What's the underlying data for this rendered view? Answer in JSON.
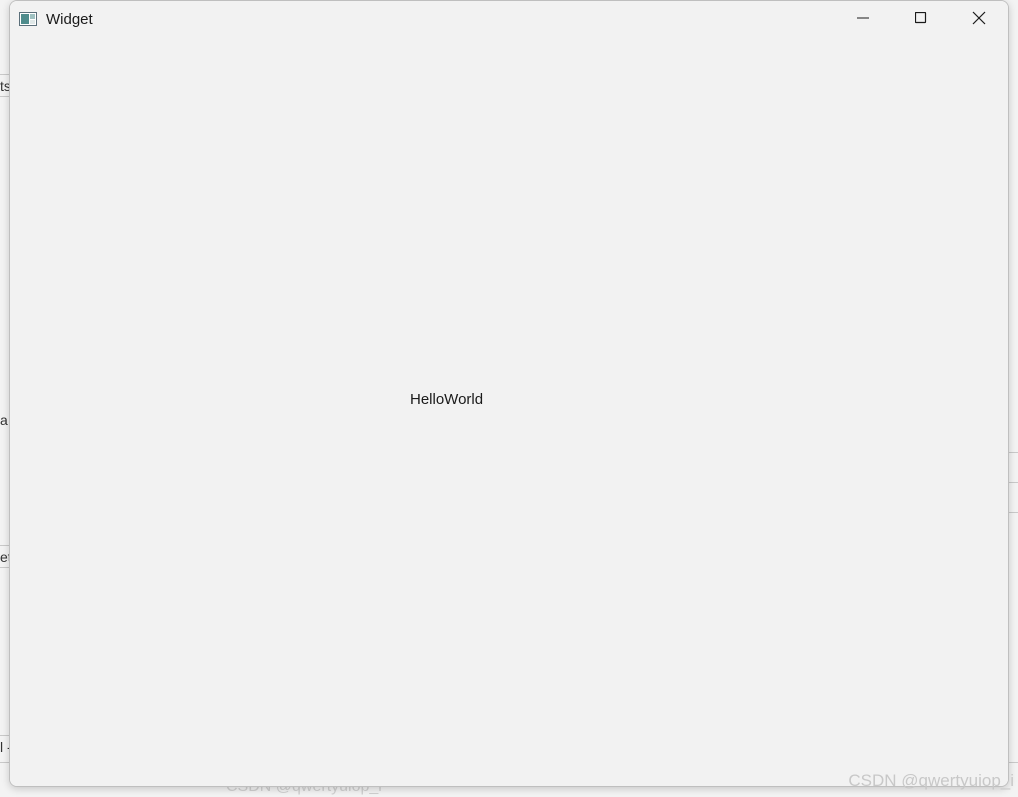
{
  "window": {
    "title": "Widget",
    "icon": "qt-widget-app-icon",
    "controls": {
      "minimize": "minimize-icon",
      "maximize": "maximize-icon",
      "close": "close-icon"
    }
  },
  "content": {
    "label": "HelloWorld"
  },
  "background": {
    "fragments": [
      "ts",
      "a",
      "et",
      "l -"
    ]
  },
  "watermark": {
    "text": "CSDN @qwertyuiop_i",
    "under_text": "CSDN @qwertyuiop_i"
  },
  "colors": {
    "window_bg": "#f2f2f2",
    "text": "#1a1a1a",
    "watermark": "#c8c8c8"
  }
}
